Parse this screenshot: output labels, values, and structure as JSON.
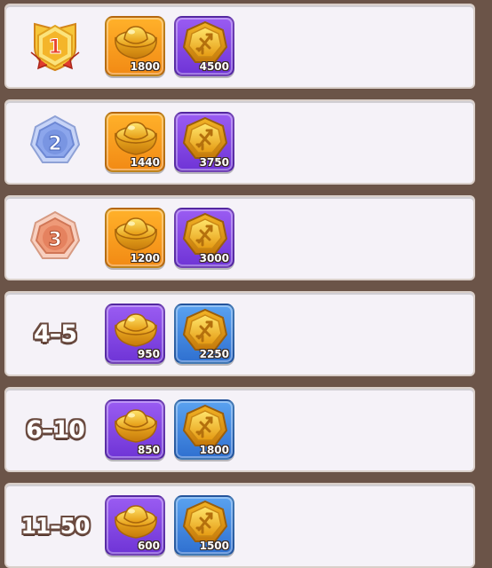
{
  "rows": [
    {
      "rank": "1",
      "ingot_amount": "1800",
      "token_amount": "4500"
    },
    {
      "rank": "2",
      "ingot_amount": "1440",
      "token_amount": "3750"
    },
    {
      "rank": "3",
      "ingot_amount": "1200",
      "token_amount": "3000"
    },
    {
      "rank": "4–5",
      "ingot_amount": "950",
      "token_amount": "2250"
    },
    {
      "rank": "6–10",
      "ingot_amount": "850",
      "token_amount": "1800"
    },
    {
      "rank": "11–50",
      "ingot_amount": "600",
      "token_amount": "1500"
    }
  ],
  "icons": {
    "reward_1": "gold-ingot-icon",
    "reward_2": "hexagon-token-icon"
  },
  "colors": {
    "gold_medal": "#f3b32a",
    "silver_medal": "#7d9ae6",
    "bronze_medal": "#e98a66",
    "orange_tile": "#f5991c",
    "purple_tile": "#8244e2",
    "blue_tile": "#3f82dc"
  }
}
